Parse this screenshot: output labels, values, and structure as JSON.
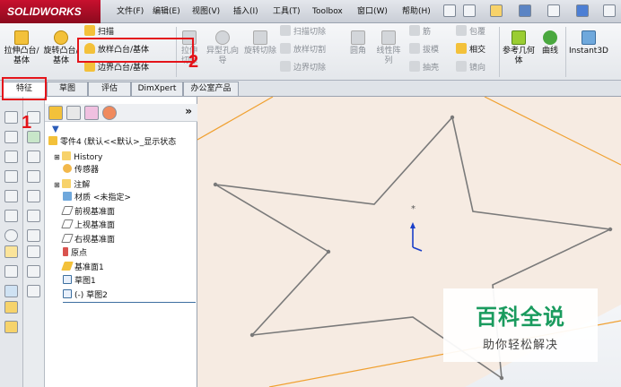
{
  "app": {
    "logo_text": "SOLIDWORKS"
  },
  "menubar": [
    "文件(F)",
    "编辑(E)",
    "视图(V)",
    "插入(I)",
    "工具(T)",
    "Toolbox",
    "窗口(W)",
    "帮助(H)"
  ],
  "ribbon": {
    "extrude_boss": "拉伸凸台/基体",
    "revolve_boss": "旋转凸台/基体",
    "sweep": "扫描",
    "loft_boss": "放样凸台/基体",
    "boundary_boss": "边界凸台/基体",
    "extrude_cut": "拉伸切除",
    "hole_wizard": "异型孔向导",
    "revolve_cut": "旋转切除",
    "sweep_cut": "扫描切除",
    "loft_cut": "放样切割",
    "boundary_cut": "边界切除",
    "fillet": "圆角",
    "linear_pattern": "线性阵列",
    "rib": "筋",
    "draft": "拔模",
    "shell": "抽壳",
    "wrap": "包覆",
    "intersect": "相交",
    "mirror": "镜向",
    "ref_geometry": "参考几何体",
    "curves": "曲线",
    "instant3d": "Instant3D"
  },
  "tabs": [
    "特征",
    "草图",
    "评估",
    "DimXpert",
    "办公室产品"
  ],
  "feature_tree": {
    "root": "零件4 (默认<<默认>_显示状态",
    "items": [
      "History",
      "传感器",
      "注解",
      "材质 <未指定>",
      "前视基准面",
      "上视基准面",
      "右视基准面",
      "原点",
      "基准面1",
      "草图1",
      "(-) 草图2"
    ]
  },
  "annotations": {
    "step1": "1",
    "step2": "2"
  },
  "watermark": {
    "title": "百科全说",
    "subtitle": "助你轻松解决"
  },
  "colors": {
    "accent_red": "#e4141a",
    "plane_orange": "#f0a030",
    "sketch_gray": "#7a7a7a"
  }
}
